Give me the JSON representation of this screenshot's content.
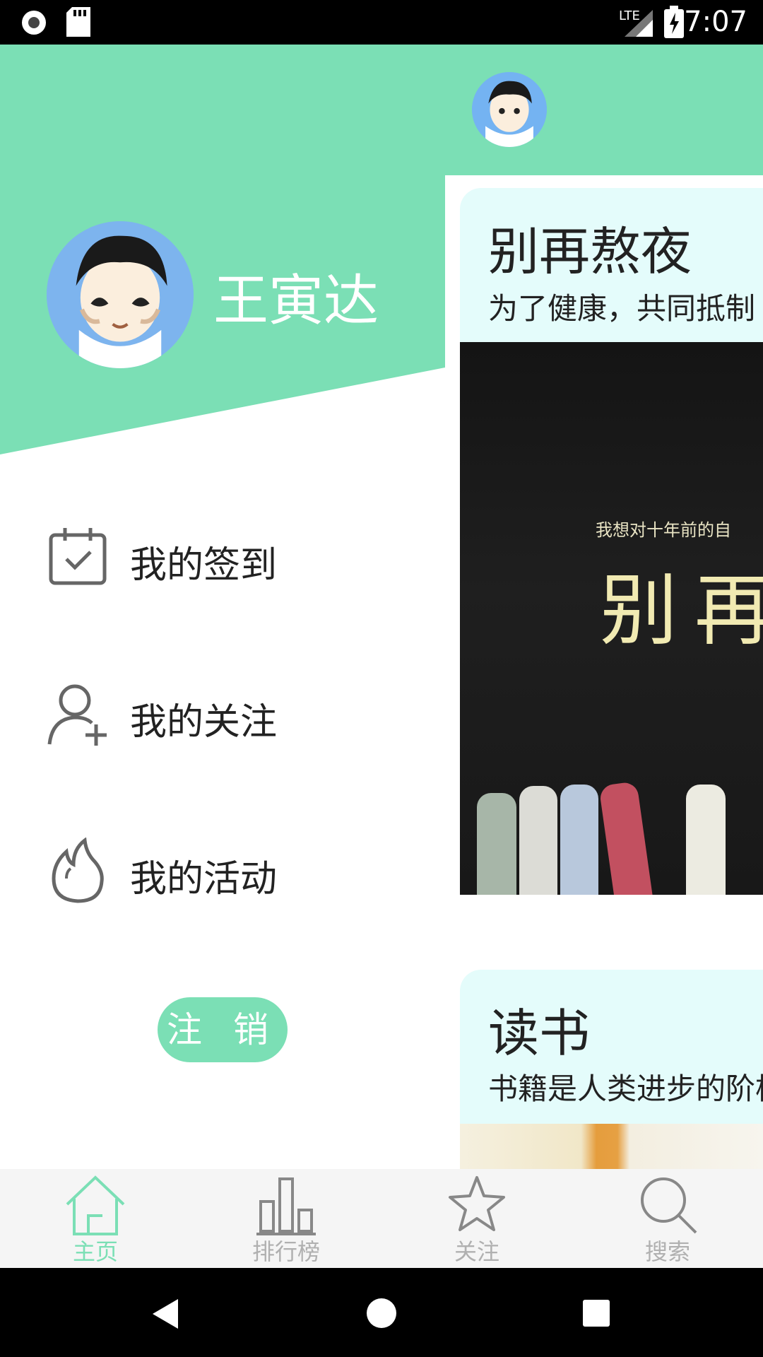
{
  "status_bar": {
    "time": "7:07",
    "network": "LTE",
    "left_icons": [
      "circle-record-icon",
      "sd-card-icon"
    ],
    "right_icons": [
      "signal-icon",
      "battery-charging-icon"
    ]
  },
  "main": {
    "cards": [
      {
        "title": "别再熬夜",
        "subtitle": "为了健康，共同抵制",
        "image_text": "别再",
        "image_caption": "我想对十年前的自"
      },
      {
        "title": "读书",
        "subtitle": "书籍是人类进步的阶梯"
      }
    ]
  },
  "drawer": {
    "username": "王寅达",
    "menu": [
      {
        "label": "我的签到",
        "icon": "calendar-check-icon"
      },
      {
        "label": "我的关注",
        "icon": "add-user-icon"
      },
      {
        "label": "我的活动",
        "icon": "flame-icon"
      }
    ],
    "logout_label": "注 销"
  },
  "bottom_nav": {
    "items": [
      {
        "label": "主页",
        "icon": "home-icon",
        "active": true
      },
      {
        "label": "排行榜",
        "icon": "bar-chart-icon",
        "active": false
      },
      {
        "label": "关注",
        "icon": "star-icon",
        "active": false
      },
      {
        "label": "搜索",
        "icon": "search-icon",
        "active": false
      }
    ]
  },
  "colors": {
    "accent": "#7bdfb5",
    "card_head": "#e4fcfb",
    "nav_bg": "#f5f5f5",
    "inactive": "#b0b0b0"
  }
}
